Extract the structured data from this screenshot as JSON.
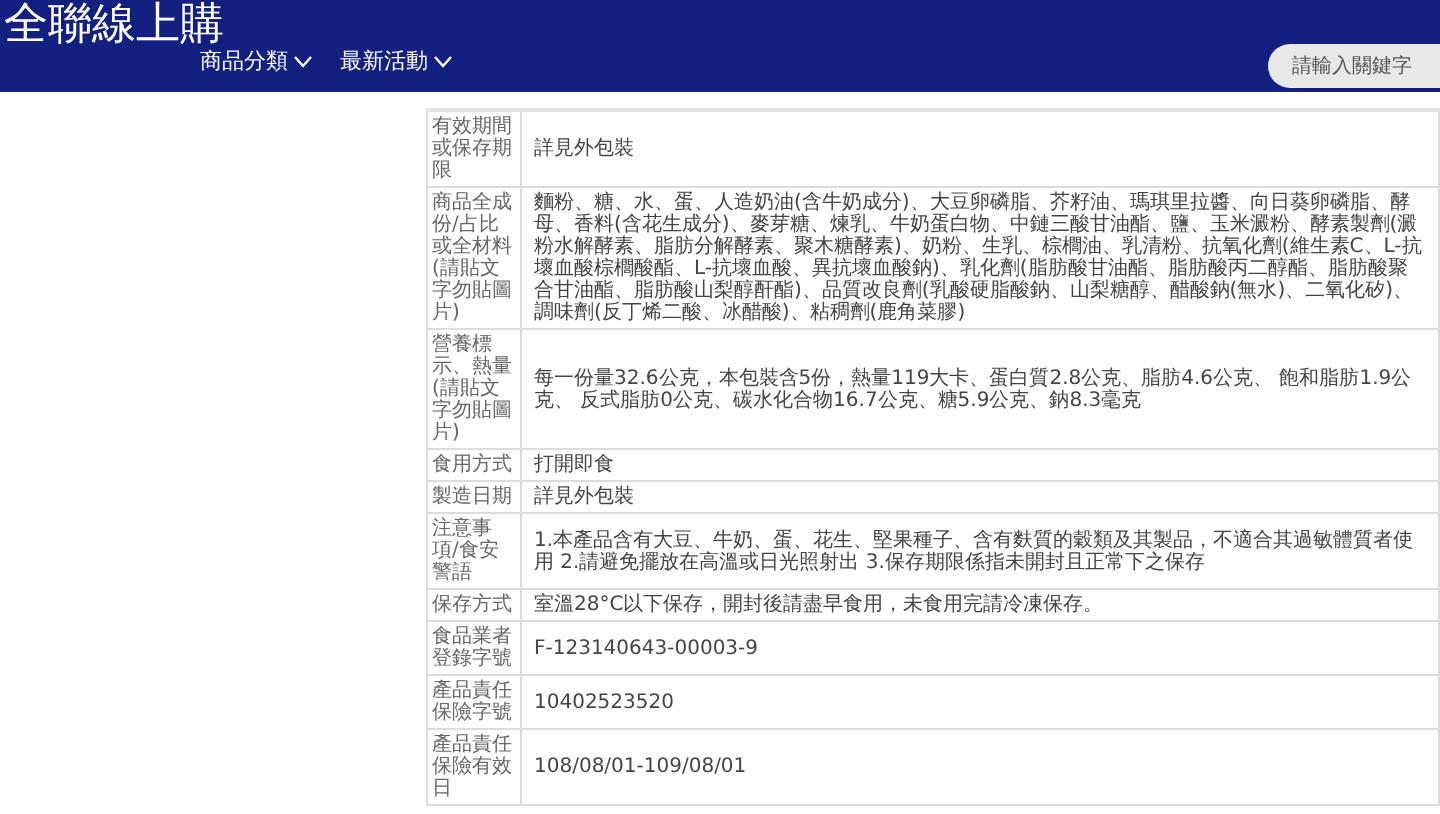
{
  "header": {
    "logo": "全聯線上購",
    "nav": [
      {
        "label": "商品分類"
      },
      {
        "label": "最新活動"
      }
    ],
    "search": {
      "placeholder": "請輸入關鍵字"
    }
  },
  "spec_table": {
    "rows": [
      {
        "label": "有效期間或保存期限",
        "value": "詳見外包裝"
      },
      {
        "label": "商品全成份/占比或全材料(請貼文字勿貼圖片)",
        "value": "麵粉、糖、水、蛋、人造奶油(含牛奶成分)、大豆卵磷脂、芥籽油、瑪琪里拉醬、向日葵卵磷脂、酵母、香料(含花生成分)、麥芽糖、煉乳、牛奶蛋白物、中鏈三酸甘油酯、鹽、玉米澱粉、酵素製劑(澱粉水解酵素、脂肪分解酵素、聚木糖酵素)、奶粉、生乳、棕櫚油、乳清粉、抗氧化劑(維生素C、L-抗壞血酸棕櫚酸酯、L-抗壞血酸、異抗壞血酸鈉)、乳化劑(脂肪酸甘油酯、脂肪酸丙二醇酯、脂肪酸聚合甘油酯、脂肪酸山梨醇酐酯)、品質改良劑(乳酸硬脂酸鈉、山梨糖醇、醋酸鈉(無水)、二氧化矽)、調味劑(反丁烯二酸、冰醋酸)、粘稠劑(鹿角菜膠)"
      },
      {
        "label": "營養標示、熱量(請貼文字勿貼圖片)",
        "value": "每一份量32.6公克，本包裝含5份，熱量119大卡、蛋白質2.8公克、脂肪4.6公克、 飽和脂肪1.9公克、 反式脂肪0公克、碳水化合物16.7公克、糖5.9公克、鈉8.3毫克"
      },
      {
        "label": "食用方式",
        "value": "打開即食"
      },
      {
        "label": "製造日期",
        "value": "詳見外包裝"
      },
      {
        "label": "注意事項/食安警語",
        "value": "1.本產品含有大豆、牛奶、蛋、花生、堅果種子、含有麩質的穀類及其製品，不適合其過敏體質者使用 2.請避免擺放在高溫或日光照射出 3.保存期限係指未開封且正常下之保存"
      },
      {
        "label": "保存方式",
        "value": "室溫28°C以下保存，開封後請盡早食用，未食用完請冷凍保存。"
      },
      {
        "label": "食品業者登錄字號",
        "value": "F-123140643-00003-9"
      },
      {
        "label": "產品責任保險字號",
        "value": "10402523520"
      },
      {
        "label": "產品責任保險有效日",
        "value": "108/08/01-109/08/01"
      }
    ]
  }
}
